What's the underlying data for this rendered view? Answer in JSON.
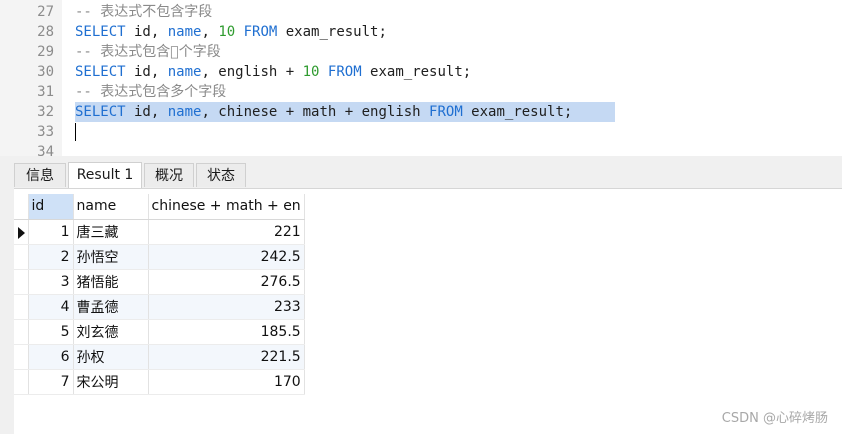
{
  "editor": {
    "line_numbers": [
      "27",
      "28",
      "29",
      "30",
      "31",
      "32",
      "33",
      "34"
    ],
    "lines": [
      {
        "type": "comment",
        "text": "-- 表达式不包含字段"
      },
      {
        "type": "code",
        "tokens": [
          {
            "k": "kw",
            "t": "SELECT"
          },
          {
            "k": "id",
            "t": " id, "
          },
          {
            "k": "kw",
            "t": "name"
          },
          {
            "k": "id",
            "t": ", "
          },
          {
            "k": "num",
            "t": "10"
          },
          {
            "k": "id",
            "t": " "
          },
          {
            "k": "kw",
            "t": "FROM"
          },
          {
            "k": "id",
            "t": " exam_result;"
          }
        ]
      },
      {
        "type": "comment",
        "text": "-- 表达式包含￿个字段"
      },
      {
        "type": "code",
        "tokens": [
          {
            "k": "kw",
            "t": "SELECT"
          },
          {
            "k": "id",
            "t": " id, "
          },
          {
            "k": "kw",
            "t": "name"
          },
          {
            "k": "id",
            "t": ", english + "
          },
          {
            "k": "num",
            "t": "10"
          },
          {
            "k": "id",
            "t": " "
          },
          {
            "k": "kw",
            "t": "FROM"
          },
          {
            "k": "id",
            "t": " exam_result;"
          }
        ]
      },
      {
        "type": "comment",
        "text": "-- 表达式包含多个字段"
      },
      {
        "type": "code",
        "tokens": [
          {
            "k": "kw",
            "t": "SELECT"
          },
          {
            "k": "id",
            "t": " id, "
          },
          {
            "k": "kw",
            "t": "name"
          },
          {
            "k": "id",
            "t": ", chinese + math + english "
          },
          {
            "k": "kw",
            "t": "FROM"
          },
          {
            "k": "id",
            "t": " exam_result;"
          }
        ]
      },
      {
        "type": "empty",
        "text": ""
      },
      {
        "type": "empty",
        "text": ""
      }
    ]
  },
  "tabs": [
    {
      "label": "信息",
      "active": false
    },
    {
      "label": "Result 1",
      "active": true
    },
    {
      "label": "概况",
      "active": false
    },
    {
      "label": "状态",
      "active": false
    }
  ],
  "grid": {
    "columns": [
      "id",
      "name",
      "chinese + math + en"
    ],
    "rows": [
      {
        "id": "1",
        "name": "唐三藏",
        "total": "221"
      },
      {
        "id": "2",
        "name": "孙悟空",
        "total": "242.5"
      },
      {
        "id": "3",
        "name": "猪悟能",
        "total": "276.5"
      },
      {
        "id": "4",
        "name": "曹孟德",
        "total": "233"
      },
      {
        "id": "5",
        "name": "刘玄德",
        "total": "185.5"
      },
      {
        "id": "6",
        "name": "孙权",
        "total": "221.5"
      },
      {
        "id": "7",
        "name": "宋公明",
        "total": "170"
      }
    ]
  },
  "watermark": "CSDN @心碎烤肠"
}
